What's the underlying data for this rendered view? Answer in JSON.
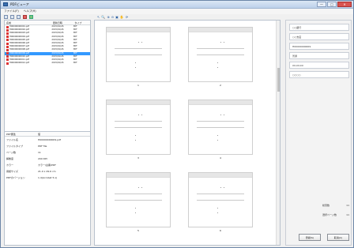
{
  "window": {
    "title": "PDFビューア",
    "controls": [
      "—",
      "□",
      "✕"
    ]
  },
  "menubar": {
    "items": [
      "ファイル(F)",
      "ヘルプ(H)"
    ]
  },
  "toolbar": {
    "icons": [
      "open-icon",
      "save-icon",
      "print-icon",
      "delete-icon",
      "refresh-icon"
    ]
  },
  "file_list": {
    "headers": [
      "名前",
      "更新日時",
      "タイプ"
    ],
    "rows": [
      {
        "name": "H00000000001.pdf",
        "date": "2015/01/26",
        "type": "PDF"
      },
      {
        "name": "H00000000002.pdf",
        "date": "2015/01/26",
        "type": "PDF"
      },
      {
        "name": "H00000000003.pdf",
        "date": "2015/01/26",
        "type": "PDF"
      },
      {
        "name": "H00000000004.pdf",
        "date": "2015/01/26",
        "type": "PDF"
      },
      {
        "name": "H00000000005.pdf",
        "date": "2015/01/26",
        "type": "PDF"
      },
      {
        "name": "H00000000006.pdf",
        "date": "2015/01/26",
        "type": "PDF"
      },
      {
        "name": "H00000000007.pdf",
        "date": "2015/01/26",
        "type": "PDF"
      },
      {
        "name": "H00000000008.pdf",
        "date": "2015/01/26",
        "type": "PDF"
      },
      {
        "name": "H00000000009.pdf",
        "date": "2015/01/26",
        "type": "PDF"
      },
      {
        "name": "H00000000010.pdf",
        "date": "2015/01/26",
        "type": "PDF"
      },
      {
        "name": "H00000000011.pdf",
        "date": "2015/01/26",
        "type": "PDF"
      },
      {
        "name": "H00000000012.pdf",
        "date": "2015/01/26",
        "type": "PDF"
      }
    ]
  },
  "properties": {
    "headers": [
      "PDF属性",
      "値"
    ],
    "rows": [
      {
        "key": "ファイル名",
        "value": "H00000000009.pdf"
      },
      {
        "key": "ファイルタイプ",
        "value": "PDF file"
      },
      {
        "key": "ページ数",
        "value": "11"
      },
      {
        "key": "解像度",
        "value": "200 DPI"
      },
      {
        "key": "カラー",
        "value": "カラー/白黒/PDF"
      },
      {
        "key": "用紙サイズ",
        "value": "21.0 x 29.6 cm"
      },
      {
        "key": "PDFのバージョン",
        "value": "1.4(Acrobat 5.x)"
      }
    ]
  },
  "viewer": {
    "zoom_tools": [
      "↖",
      "🔍",
      "⊕",
      "⊖",
      "▣",
      "✋",
      "⟳"
    ],
    "thumbnails": [
      "1",
      "2",
      "3",
      "4",
      "5",
      "6"
    ]
  },
  "right_panel": {
    "fields": [
      "○○銀行",
      "○○支店",
      "H00000000009",
      "普通",
      "XX-XX-XX",
      "○○○○"
    ],
    "summary": [
      {
        "label": "総頁数",
        "value": "11"
      },
      {
        "label": "選択ページ数",
        "value": "11"
      }
    ],
    "buttons": [
      "登録(S)",
      "取消(C)"
    ]
  },
  "colors": {
    "selection": "#3399ff",
    "pdf_icon": "#dd3333",
    "title_bg": "#cfe0f5"
  }
}
